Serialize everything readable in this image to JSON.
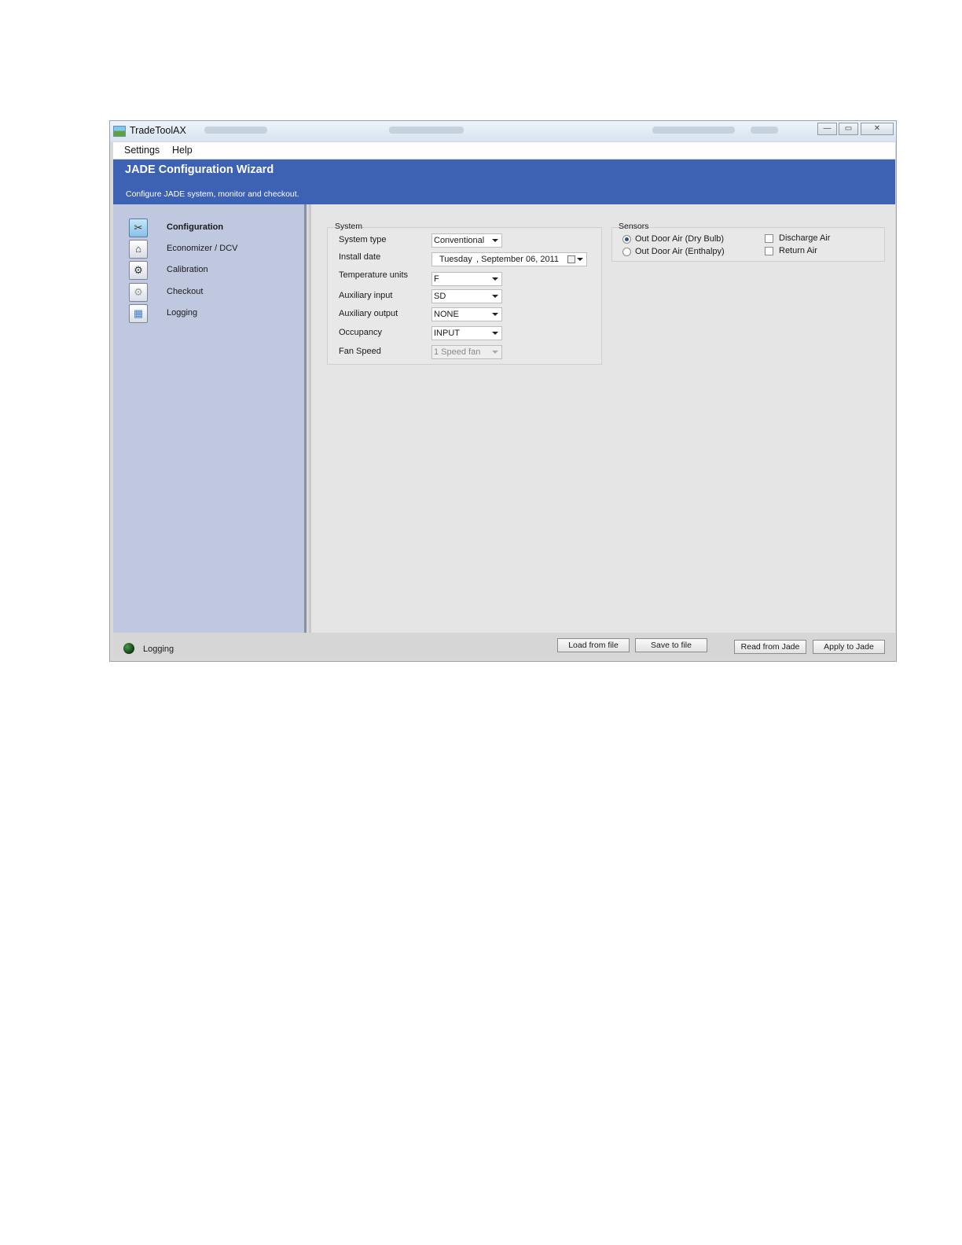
{
  "window": {
    "title": "TradeToolAX",
    "controls": {
      "minimize": "—",
      "maximize": "▭",
      "close": "✕"
    }
  },
  "menu": {
    "items": [
      "Settings",
      "Help"
    ]
  },
  "banner": {
    "title": "JADE Configuration Wizard",
    "subtitle": "Configure JADE system, monitor and checkout."
  },
  "sidebar": {
    "items": [
      {
        "label": "Configuration",
        "icon": "tools-icon",
        "glyph": "✂",
        "active": true
      },
      {
        "label": "Economizer / DCV",
        "icon": "economizer-icon",
        "glyph": "⌂",
        "active": false
      },
      {
        "label": "Calibration",
        "icon": "calibration-icon",
        "glyph": "⚙",
        "active": false
      },
      {
        "label": "Checkout",
        "icon": "gear-icon",
        "glyph": "⚙",
        "active": false
      },
      {
        "label": "Logging",
        "icon": "logging-icon",
        "glyph": "▦",
        "active": false
      }
    ]
  },
  "system": {
    "title": "System",
    "fields": [
      {
        "label": "System type",
        "value": "Conventional",
        "disabled": false
      },
      {
        "label": "Install date",
        "day": "Tuesday",
        "date": ", September 06, 2011",
        "type": "date"
      },
      {
        "label": "Temperature units",
        "value": "F",
        "disabled": false
      },
      {
        "label": "Auxiliary input",
        "value": "SD",
        "disabled": false
      },
      {
        "label": "Auxiliary output",
        "value": "NONE",
        "disabled": false
      },
      {
        "label": "Occupancy",
        "value": "INPUT",
        "disabled": false
      },
      {
        "label": "Fan Speed",
        "value": "1 Speed fan",
        "disabled": true
      }
    ]
  },
  "sensors": {
    "title": "Sensors",
    "radios": [
      {
        "label": "Out Door Air (Dry Bulb)",
        "checked": true
      },
      {
        "label": "Out Door Air (Enthalpy)",
        "checked": false
      }
    ],
    "checkboxes": [
      {
        "label": "Discharge Air",
        "checked": false
      },
      {
        "label": "Return Air",
        "checked": false
      }
    ]
  },
  "status": {
    "label": "Logging"
  },
  "buttons": {
    "load": "Load from file",
    "save": "Save to  file",
    "read": "Read from Jade",
    "apply": "Apply to Jade"
  }
}
